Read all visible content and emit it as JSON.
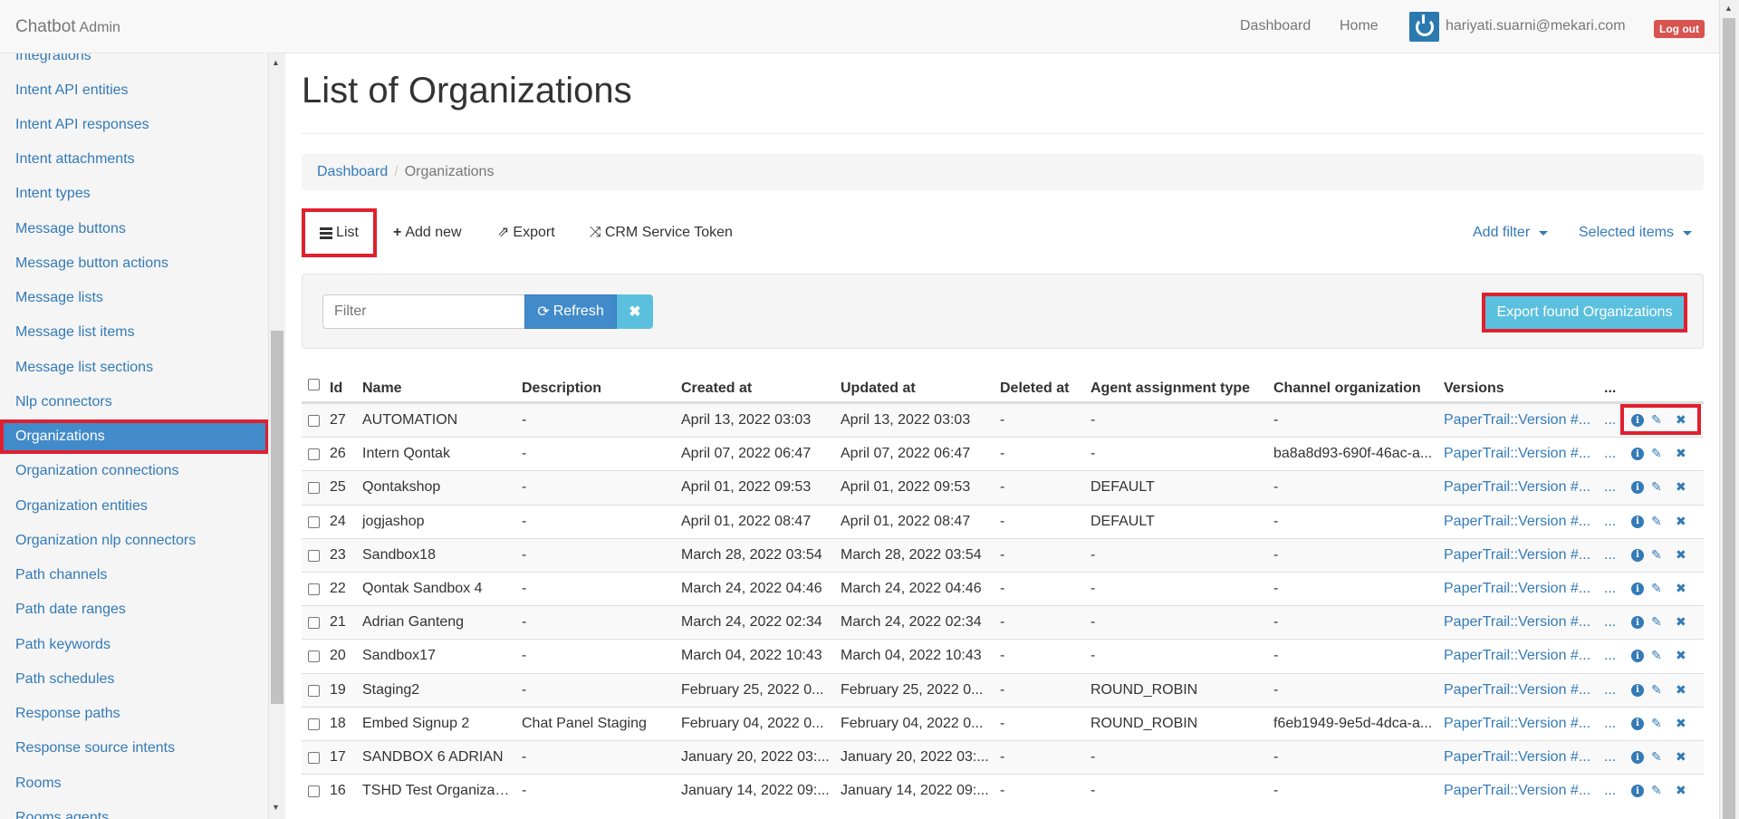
{
  "navbar": {
    "brand": "Chatbot",
    "brand_sub": "Admin",
    "links": [
      "Dashboard",
      "Home"
    ],
    "user_email": "hariyati.suarni@mekari.com",
    "logout": "Log out"
  },
  "sidebar": {
    "items": [
      {
        "label": "Integrations",
        "active": false
      },
      {
        "label": "Intent API entities",
        "active": false
      },
      {
        "label": "Intent API responses",
        "active": false
      },
      {
        "label": "Intent attachments",
        "active": false
      },
      {
        "label": "Intent types",
        "active": false
      },
      {
        "label": "Message buttons",
        "active": false
      },
      {
        "label": "Message button actions",
        "active": false
      },
      {
        "label": "Message lists",
        "active": false
      },
      {
        "label": "Message list items",
        "active": false
      },
      {
        "label": "Message list sections",
        "active": false
      },
      {
        "label": "Nlp connectors",
        "active": false
      },
      {
        "label": "Organizations",
        "active": true
      },
      {
        "label": "Organization connections",
        "active": false
      },
      {
        "label": "Organization entities",
        "active": false
      },
      {
        "label": "Organization nlp connectors",
        "active": false
      },
      {
        "label": "Path channels",
        "active": false
      },
      {
        "label": "Path date ranges",
        "active": false
      },
      {
        "label": "Path keywords",
        "active": false
      },
      {
        "label": "Path schedules",
        "active": false
      },
      {
        "label": "Response paths",
        "active": false
      },
      {
        "label": "Response source intents",
        "active": false
      },
      {
        "label": "Rooms",
        "active": false
      },
      {
        "label": "Rooms agents",
        "active": false
      }
    ]
  },
  "main": {
    "title": "List of Organizations",
    "breadcrumb": {
      "home": "Dashboard",
      "current": "Organizations"
    },
    "tabs": {
      "list": "List",
      "add_new": "Add new",
      "export": "Export",
      "crm_token": "CRM Service Token",
      "add_filter": "Add filter",
      "selected_items": "Selected items"
    },
    "filter": {
      "placeholder": "Filter",
      "refresh": "Refresh",
      "export_found": "Export found Organizations"
    },
    "table": {
      "headers": {
        "id": "Id",
        "name": "Name",
        "description": "Description",
        "created_at": "Created at",
        "updated_at": "Updated at",
        "deleted_at": "Deleted at",
        "agent_assignment_type": "Agent assignment type",
        "channel_organization": "Channel organization",
        "versions": "Versions",
        "more": "..."
      },
      "rows": [
        {
          "id": "27",
          "name": "AUTOMATION",
          "description": "-",
          "created_at": "April 13, 2022 03:03",
          "updated_at": "April 13, 2022 03:03",
          "deleted_at": "-",
          "agent_assignment_type": "-",
          "channel_organization": "-",
          "versions": "PaperTrail::Version #...",
          "more": "..."
        },
        {
          "id": "26",
          "name": "Intern Qontak",
          "description": "-",
          "created_at": "April 07, 2022 06:47",
          "updated_at": "April 07, 2022 06:47",
          "deleted_at": "-",
          "agent_assignment_type": "-",
          "channel_organization": "ba8a8d93-690f-46ac-a...",
          "versions": "PaperTrail::Version #...",
          "more": "..."
        },
        {
          "id": "25",
          "name": "Qontakshop",
          "description": "-",
          "created_at": "April 01, 2022 09:53",
          "updated_at": "April 01, 2022 09:53",
          "deleted_at": "-",
          "agent_assignment_type": "DEFAULT",
          "channel_organization": "-",
          "versions": "PaperTrail::Version #...",
          "more": "..."
        },
        {
          "id": "24",
          "name": "jogjashop",
          "description": "-",
          "created_at": "April 01, 2022 08:47",
          "updated_at": "April 01, 2022 08:47",
          "deleted_at": "-",
          "agent_assignment_type": "DEFAULT",
          "channel_organization": "-",
          "versions": "PaperTrail::Version #...",
          "more": "..."
        },
        {
          "id": "23",
          "name": "Sandbox18",
          "description": "-",
          "created_at": "March 28, 2022 03:54",
          "updated_at": "March 28, 2022 03:54",
          "deleted_at": "-",
          "agent_assignment_type": "-",
          "channel_organization": "-",
          "versions": "PaperTrail::Version #...",
          "more": "..."
        },
        {
          "id": "22",
          "name": "Qontak Sandbox 4",
          "description": "-",
          "created_at": "March 24, 2022 04:46",
          "updated_at": "March 24, 2022 04:46",
          "deleted_at": "-",
          "agent_assignment_type": "-",
          "channel_organization": "-",
          "versions": "PaperTrail::Version #...",
          "more": "..."
        },
        {
          "id": "21",
          "name": "Adrian Ganteng",
          "description": "-",
          "created_at": "March 24, 2022 02:34",
          "updated_at": "March 24, 2022 02:34",
          "deleted_at": "-",
          "agent_assignment_type": "-",
          "channel_organization": "-",
          "versions": "PaperTrail::Version #...",
          "more": "..."
        },
        {
          "id": "20",
          "name": "Sandbox17",
          "description": "-",
          "created_at": "March 04, 2022 10:43",
          "updated_at": "March 04, 2022 10:43",
          "deleted_at": "-",
          "agent_assignment_type": "-",
          "channel_organization": "-",
          "versions": "PaperTrail::Version #...",
          "more": "..."
        },
        {
          "id": "19",
          "name": "Staging2",
          "description": "-",
          "created_at": "February 25, 2022 0...",
          "updated_at": "February 25, 2022 0...",
          "deleted_at": "-",
          "agent_assignment_type": "ROUND_ROBIN",
          "channel_organization": "-",
          "versions": "PaperTrail::Version #...",
          "more": "..."
        },
        {
          "id": "18",
          "name": "Embed Signup 2",
          "description": "Chat Panel Staging",
          "created_at": "February 04, 2022 0...",
          "updated_at": "February 04, 2022 0...",
          "deleted_at": "-",
          "agent_assignment_type": "ROUND_ROBIN",
          "channel_organization": "f6eb1949-9e5d-4dca-a...",
          "versions": "PaperTrail::Version #...",
          "more": "..."
        },
        {
          "id": "17",
          "name": "SANDBOX 6 ADRIAN",
          "description": "-",
          "created_at": "January 20, 2022 03:...",
          "updated_at": "January 20, 2022 03:...",
          "deleted_at": "-",
          "agent_assignment_type": "-",
          "channel_organization": "-",
          "versions": "PaperTrail::Version #...",
          "more": "..."
        },
        {
          "id": "16",
          "name": "TSHD Test Organizat...",
          "description": "-",
          "created_at": "January 14, 2022 09:...",
          "updated_at": "January 14, 2022 09:...",
          "deleted_at": "-",
          "agent_assignment_type": "-",
          "channel_organization": "-",
          "versions": "PaperTrail::Version #...",
          "more": "..."
        }
      ]
    }
  },
  "colors": {
    "link": "#337ab7",
    "active": "#428bca",
    "highlight": "#e0202e",
    "info_button": "#5bc0de",
    "danger": "#d9534f"
  }
}
